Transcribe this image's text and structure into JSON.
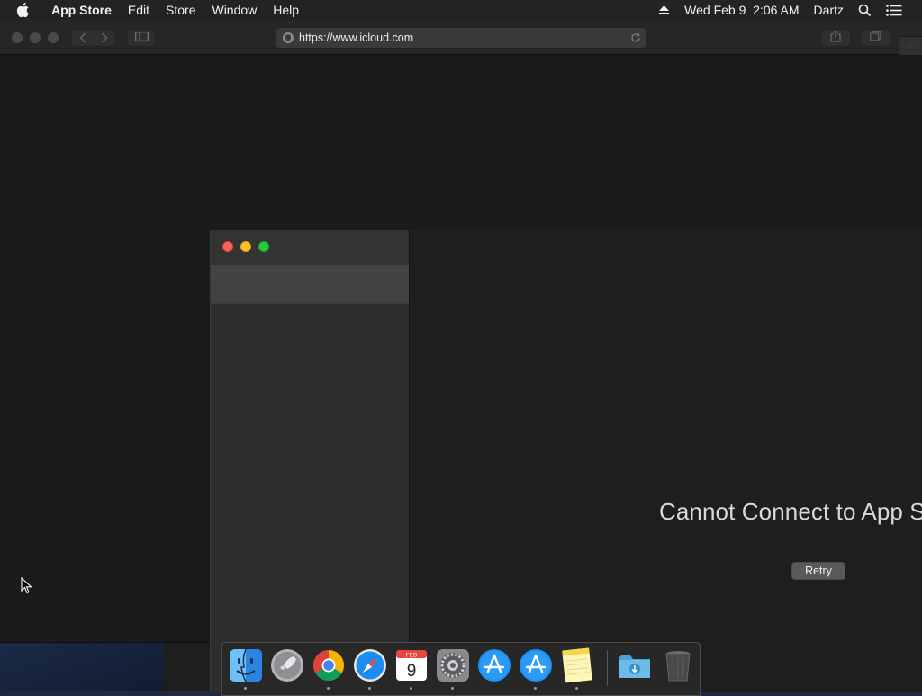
{
  "menubar": {
    "app_name": "App Store",
    "items": [
      "Edit",
      "Store",
      "Window",
      "Help"
    ],
    "clock": "Wed Feb 9  2:06 AM",
    "user": "Dartz"
  },
  "browser": {
    "url": "https://www.icloud.com"
  },
  "appstore": {
    "message": "Cannot Connect to App Store",
    "retry_label": "Retry"
  },
  "dock": {
    "calendar_month": "FEB",
    "calendar_day": "9",
    "items": [
      "finder-icon",
      "launchpad-icon",
      "chrome-icon",
      "safari-icon",
      "calendar-icon",
      "system-preferences-icon",
      "app-store-icon",
      "app-store-icon",
      "notes-icon",
      "downloads-folder-icon",
      "trash-icon"
    ]
  },
  "colors": {
    "close": "#ff5f57",
    "minimize": "#febc2e",
    "zoom": "#28c840",
    "accent_blue": "#1d8cf0"
  }
}
